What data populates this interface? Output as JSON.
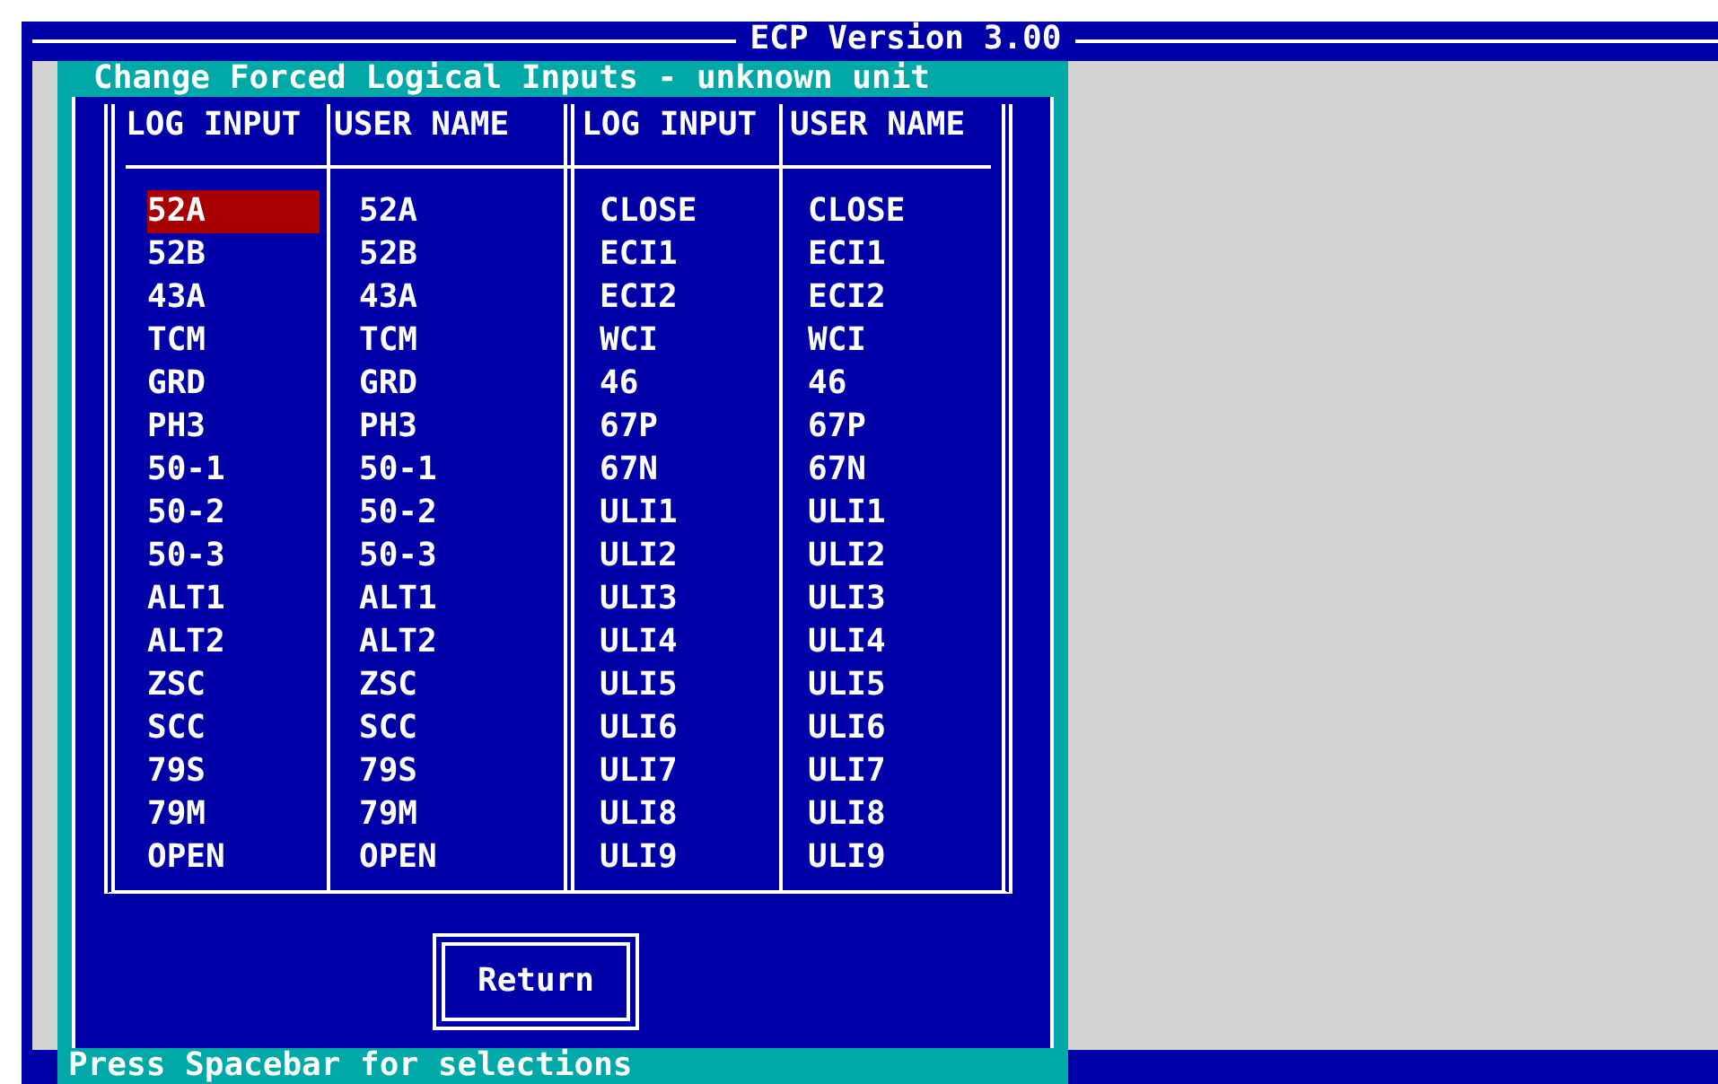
{
  "window": {
    "title": "ECP Version 3.00"
  },
  "dialog": {
    "title": "Change Forced Logical Inputs - unknown unit",
    "status": "Press Spacebar for selections"
  },
  "table": {
    "columns": [
      "LOG INPUT",
      "USER NAME",
      "LOG INPUT",
      "USER NAME"
    ],
    "rows": [
      {
        "cells": [
          "52A",
          "52A",
          "CLOSE",
          "CLOSE"
        ],
        "selected": true
      },
      {
        "cells": [
          "52B",
          "52B",
          "ECI1",
          "ECI1"
        ],
        "selected": false
      },
      {
        "cells": [
          "43A",
          "43A",
          "ECI2",
          "ECI2"
        ],
        "selected": false
      },
      {
        "cells": [
          "TCM",
          "TCM",
          "WCI",
          "WCI"
        ],
        "selected": false
      },
      {
        "cells": [
          "GRD",
          "GRD",
          "46",
          "46"
        ],
        "selected": false
      },
      {
        "cells": [
          "PH3",
          "PH3",
          "67P",
          "67P"
        ],
        "selected": false
      },
      {
        "cells": [
          "50-1",
          "50-1",
          "67N",
          "67N"
        ],
        "selected": false
      },
      {
        "cells": [
          "50-2",
          "50-2",
          "ULI1",
          "ULI1"
        ],
        "selected": false
      },
      {
        "cells": [
          "50-3",
          "50-3",
          "ULI2",
          "ULI2"
        ],
        "selected": false
      },
      {
        "cells": [
          "ALT1",
          "ALT1",
          "ULI3",
          "ULI3"
        ],
        "selected": false
      },
      {
        "cells": [
          "ALT2",
          "ALT2",
          "ULI4",
          "ULI4"
        ],
        "selected": false
      },
      {
        "cells": [
          "ZSC",
          "ZSC",
          "ULI5",
          "ULI5"
        ],
        "selected": false
      },
      {
        "cells": [
          "SCC",
          "SCC",
          "ULI6",
          "ULI6"
        ],
        "selected": false
      },
      {
        "cells": [
          "79S",
          "79S",
          "ULI7",
          "ULI7"
        ],
        "selected": false
      },
      {
        "cells": [
          "79M",
          "79M",
          "ULI8",
          "ULI8"
        ],
        "selected": false
      },
      {
        "cells": [
          "OPEN",
          "OPEN",
          "ULI9",
          "ULI9"
        ],
        "selected": false
      }
    ]
  },
  "buttons": [
    "Return"
  ]
}
